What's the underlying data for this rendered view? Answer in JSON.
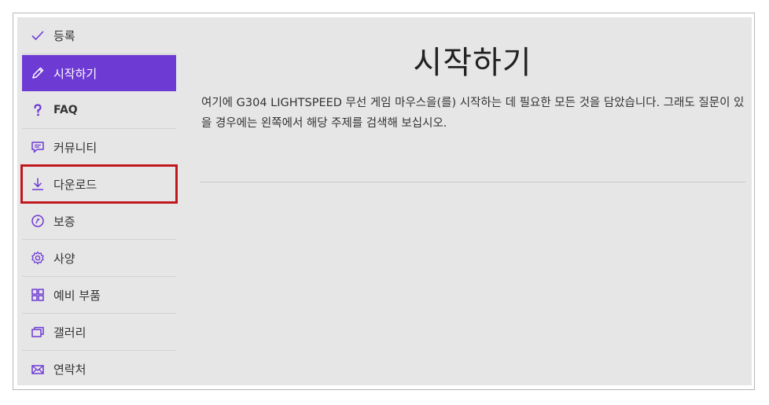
{
  "sidebar": {
    "items": [
      {
        "label": "등록",
        "icon": "check-icon"
      },
      {
        "label": "시작하기",
        "icon": "pencil-icon",
        "active": true
      },
      {
        "label": "FAQ",
        "icon": "question-icon"
      },
      {
        "label": "커뮤니티",
        "icon": "chat-icon"
      },
      {
        "label": "다운로드",
        "icon": "download-icon",
        "highlighted": true
      },
      {
        "label": "보증",
        "icon": "warranty-icon"
      },
      {
        "label": "사양",
        "icon": "gear-icon"
      },
      {
        "label": "예비 부품",
        "icon": "grid-icon"
      },
      {
        "label": "갤러리",
        "icon": "gallery-icon"
      },
      {
        "label": "연락처",
        "icon": "mail-icon"
      }
    ]
  },
  "main": {
    "title": "시작하기",
    "intro": "여기에 G304 LIGHTSPEED 무선 게임 마우스을(를) 시작하는 데 필요한 모든 것을 담았습니다. 그래도 질문이 있을 경우에는 왼쪽에서 해당 주제를 검색해 보십시오."
  },
  "colors": {
    "accent": "#6e3ad4",
    "highlight_border": "#c0181f",
    "background": "#e6e6e6"
  }
}
